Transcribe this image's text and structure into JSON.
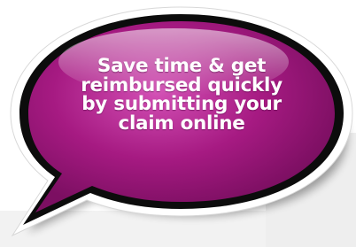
{
  "callout": {
    "lines": [
      "Save time & get",
      "reimbursed quickly",
      "by submitting your",
      "claim online"
    ]
  },
  "colors": {
    "bubble_fill": "#a2187f",
    "bubble_highlight": "#d86cbf",
    "bubble_border": "#0c0c0c",
    "outer_rim": "#ffffff",
    "text": "#ffffff",
    "background": "#ffffff"
  }
}
